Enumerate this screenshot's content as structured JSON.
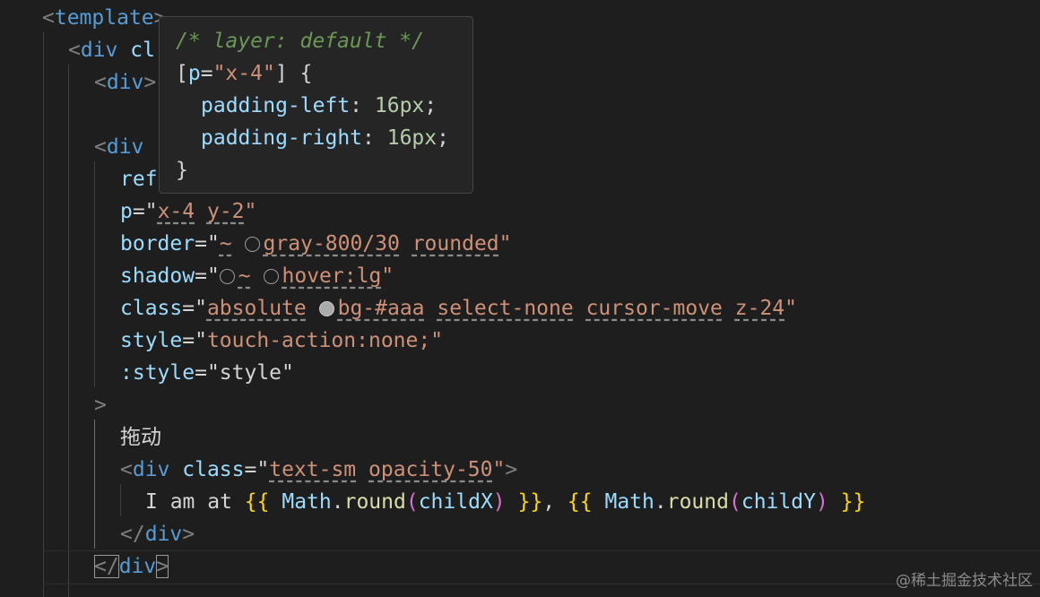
{
  "code": {
    "l1": {
      "open": "<",
      "name": "template",
      "close": ">"
    },
    "l2": {
      "open": "<",
      "name": "div",
      "rest": " cl"
    },
    "l3": {
      "open": "<",
      "name": "div",
      "close": ">"
    },
    "l4": {
      "open": "<",
      "name": "div"
    },
    "l5": {
      "attr": "ref"
    },
    "l6": {
      "attr": "p",
      "eq": "=\"",
      "v1": "x-4",
      "v2": "y-2",
      "q": "\""
    },
    "l7": {
      "attr": "border",
      "eq": "=\"",
      "v1": "~",
      "v2": "gray-800/30",
      "v3": "rounded",
      "q": "\""
    },
    "l8": {
      "attr": "shadow",
      "eq": "=\"",
      "v1": "~",
      "v2": "hover:lg",
      "q": "\""
    },
    "l9": {
      "attr": "class",
      "eq": "=\"",
      "v1": "absolute",
      "v2": "bg-#aaa",
      "v3": "select-none",
      "v4": "cursor-move",
      "v5": "z-24",
      "q": "\""
    },
    "l10": {
      "attr": "style",
      "eq": "=\"",
      "v1": "touch-action:none;",
      "q": "\""
    },
    "l11": {
      "attr": ":style",
      "eq": "=\"",
      "v1": "style",
      "q": "\""
    },
    "l12": {
      "text": ">"
    },
    "l13": {
      "text": "拖动"
    },
    "l14": {
      "open": "<",
      "name": "div",
      "attr": "class",
      "eq": "=\"",
      "v1": "text-sm",
      "v2": "opacity-50",
      "q": "\"",
      "close": ">"
    },
    "l15": {
      "t1": "I am at ",
      "b1": "{{",
      "ident1": "Math",
      "dot": ".",
      "fn1": "round",
      "p1": "(",
      "arg1": "childX",
      "p2": ")",
      "b2": "}}",
      "comma": ", ",
      "b3": "{{",
      "ident2": "Math",
      "dot2": ".",
      "fn2": "round",
      "p3": "(",
      "arg2": "childY",
      "p4": ")",
      "b4": "}}"
    },
    "l16": {
      "open": "</",
      "name": "div",
      "close": ">"
    },
    "l17": {
      "open": "</",
      "name": "div",
      "close": ">"
    }
  },
  "tooltip": {
    "comment": "/* layer: default */",
    "sel_open": "[",
    "sel_attr": "p",
    "sel_eq": "=",
    "sel_val": "\"x-4\"",
    "sel_close": "] {",
    "p1_name": "padding-left",
    "p1_colon": ": ",
    "p1_val": "16px",
    "semi": ";",
    "p2_name": "padding-right",
    "p2_colon": ": ",
    "p2_val": "16px",
    "end": "}"
  },
  "watermark": "@稀土掘金技术社区"
}
